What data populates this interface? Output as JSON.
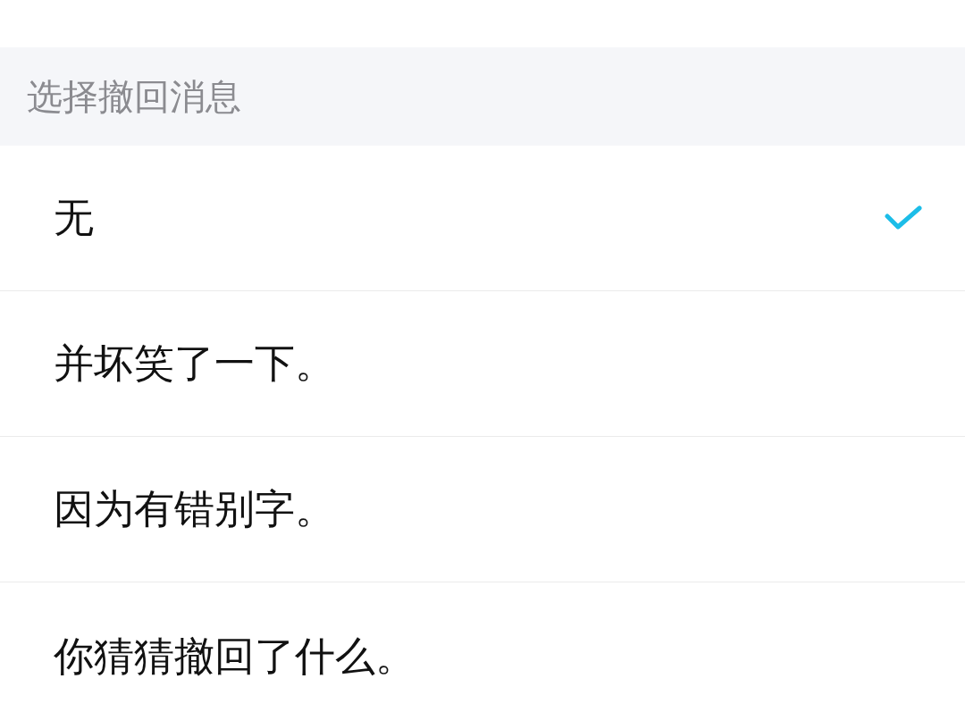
{
  "section_header": {
    "title": "选择撤回消息"
  },
  "options": [
    {
      "label": "无",
      "selected": true
    },
    {
      "label": "并坏笑了一下。",
      "selected": false
    },
    {
      "label": "因为有错别字。",
      "selected": false
    },
    {
      "label": "你猜猜撤回了什么。",
      "selected": false
    }
  ]
}
